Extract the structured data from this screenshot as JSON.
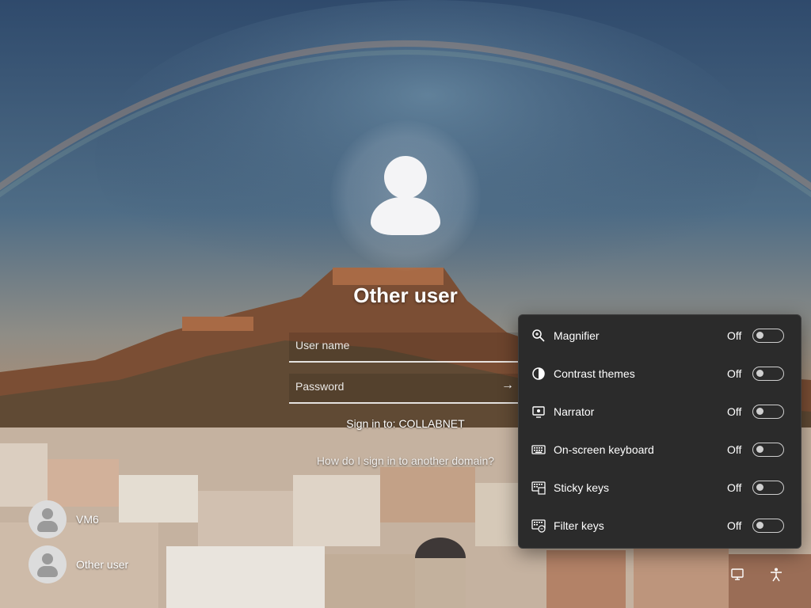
{
  "login": {
    "user_title": "Other user",
    "username_placeholder": "User name",
    "password_placeholder": "Password",
    "submit_arrow": "→",
    "sign_in_to": "Sign in to: COLLABNET",
    "domain_help_link": "How do I sign in to another domain?"
  },
  "users": [
    {
      "label": "VM6",
      "icon": "user-avatar-icon"
    },
    {
      "label": "Other user",
      "icon": "user-avatar-icon"
    }
  ],
  "accessibility_flyout": {
    "items": [
      {
        "label": "Magnifier",
        "state": "Off",
        "icon": "magnifier-icon",
        "on": false
      },
      {
        "label": "Contrast themes",
        "state": "Off",
        "icon": "contrast-icon",
        "on": false
      },
      {
        "label": "Narrator",
        "state": "Off",
        "icon": "narrator-icon",
        "on": false
      },
      {
        "label": "On-screen keyboard",
        "state": "Off",
        "icon": "keyboard-icon",
        "on": false
      },
      {
        "label": "Sticky keys",
        "state": "Off",
        "icon": "sticky-keys-icon",
        "on": false
      },
      {
        "label": "Filter keys",
        "state": "Off",
        "icon": "filter-keys-icon",
        "on": false
      }
    ]
  },
  "tray": {
    "icons": [
      "network-icon",
      "accessibility-icon"
    ]
  },
  "colors": {
    "flyout_bg": "#2b2b2b",
    "toggle_off": "#cfcfcf"
  }
}
